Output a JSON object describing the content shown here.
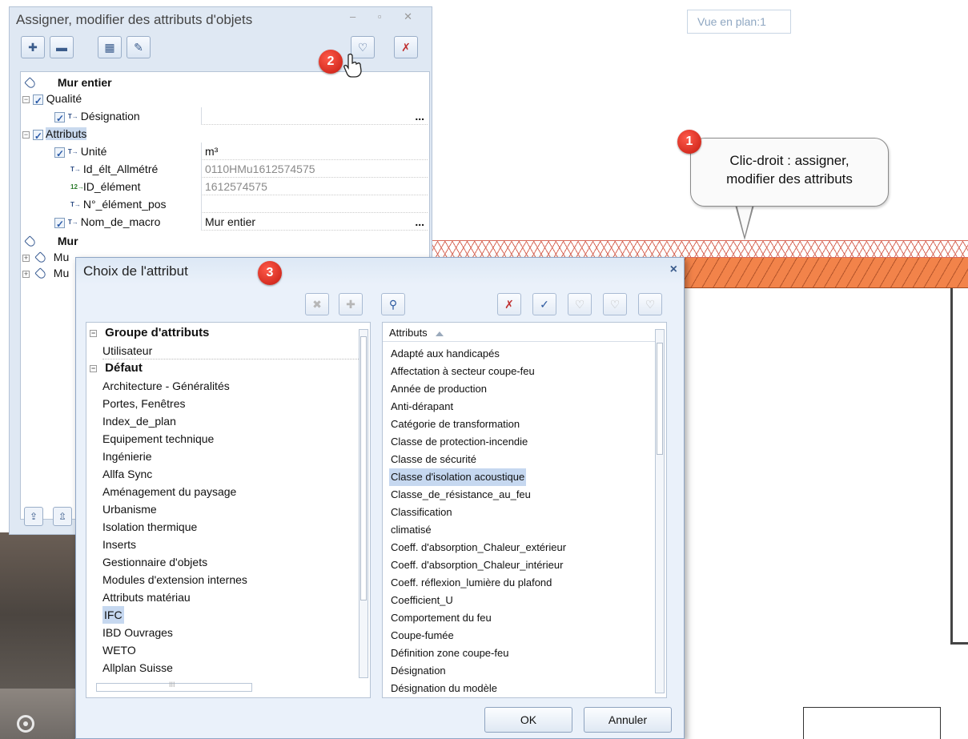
{
  "canvas": {
    "view_label": "Vue en plan:1",
    "callout_line1": "Clic-droit : assigner,",
    "callout_line2": "modifier des attributs"
  },
  "badges": [
    "1",
    "2",
    "3"
  ],
  "panel": {
    "title": "Assigner, modifier des attributs d'objets",
    "win_controls": "– ▫ ✕",
    "toolbar_icons": [
      "add-icon",
      "remove-icon",
      "grid-icon",
      "paint-icon",
      "assign-tag-icon",
      "delete-tag-icon"
    ],
    "tree": {
      "group1": "Mur entier",
      "qualite": "Qualité",
      "designation": "Désignation",
      "attributs": "Attributs",
      "unite": "Unité",
      "unite_val": "m³",
      "id_elt_allmetre": "Id_élt_Allmétré",
      "id_elt_allmetre_val": "0110HMu1612574575",
      "id_element": "ID_élément",
      "id_element_val": "1612574575",
      "no_element_pos": "N°_élément_pos",
      "nom_de_macro": "Nom_de_macro",
      "nom_de_macro_val": "Mur entier",
      "group2": "Mur",
      "collapsed1": "Mu",
      "collapsed2": "Mu",
      "dots": "..."
    }
  },
  "dialog": {
    "title": "Choix de l'attribut",
    "close": "×",
    "toolbar_icons": [
      "delete-icon",
      "add-icon",
      "search-icon",
      "uncheck-all-icon",
      "check-all-icon",
      "tag-icon",
      "tag-remove-icon",
      "tag-clear-icon"
    ],
    "left_list": {
      "group_header": "Groupe d'attributs",
      "items": [
        "Utilisateur",
        "Défaut",
        "Architecture - Généralités",
        "Portes, Fenêtres",
        "Index_de_plan",
        "Equipement technique",
        "Ingénierie",
        "Allfa Sync",
        "Aménagement du paysage",
        "Urbanisme",
        "Isolation thermique",
        "Inserts",
        "Gestionnaire d'objets",
        "Modules d'extension internes",
        "Attributs matériau",
        "IFC",
        "IBD Ouvrages",
        "WETO",
        "Allplan Suisse"
      ],
      "selected": "IFC",
      "hscroll_label": "III"
    },
    "right_list": {
      "header": "Attributs",
      "items": [
        "Adapté aux handicapés",
        "Affectation à secteur coupe-feu",
        "Année de production",
        "Anti-dérapant",
        "Catégorie de transformation",
        "Classe de protection-incendie",
        "Classe de sécurité",
        "Classe d'isolation acoustique",
        "Classe_de_résistance_au_feu",
        "Classification",
        "climatisé",
        "Coeff. d'absorption_Chaleur_extérieur",
        "Coeff. d'absorption_Chaleur_intérieur",
        "Coeff. réflexion_lumière du plafond",
        "Coefficient_U",
        "Comportement du feu",
        "Coupe-fumée",
        "Définition zone coupe-feu",
        "Désignation",
        "Désignation du modèle"
      ],
      "selected": "Classe d'isolation acoustique"
    },
    "ok_label": "OK",
    "cancel_label": "Annuler"
  }
}
